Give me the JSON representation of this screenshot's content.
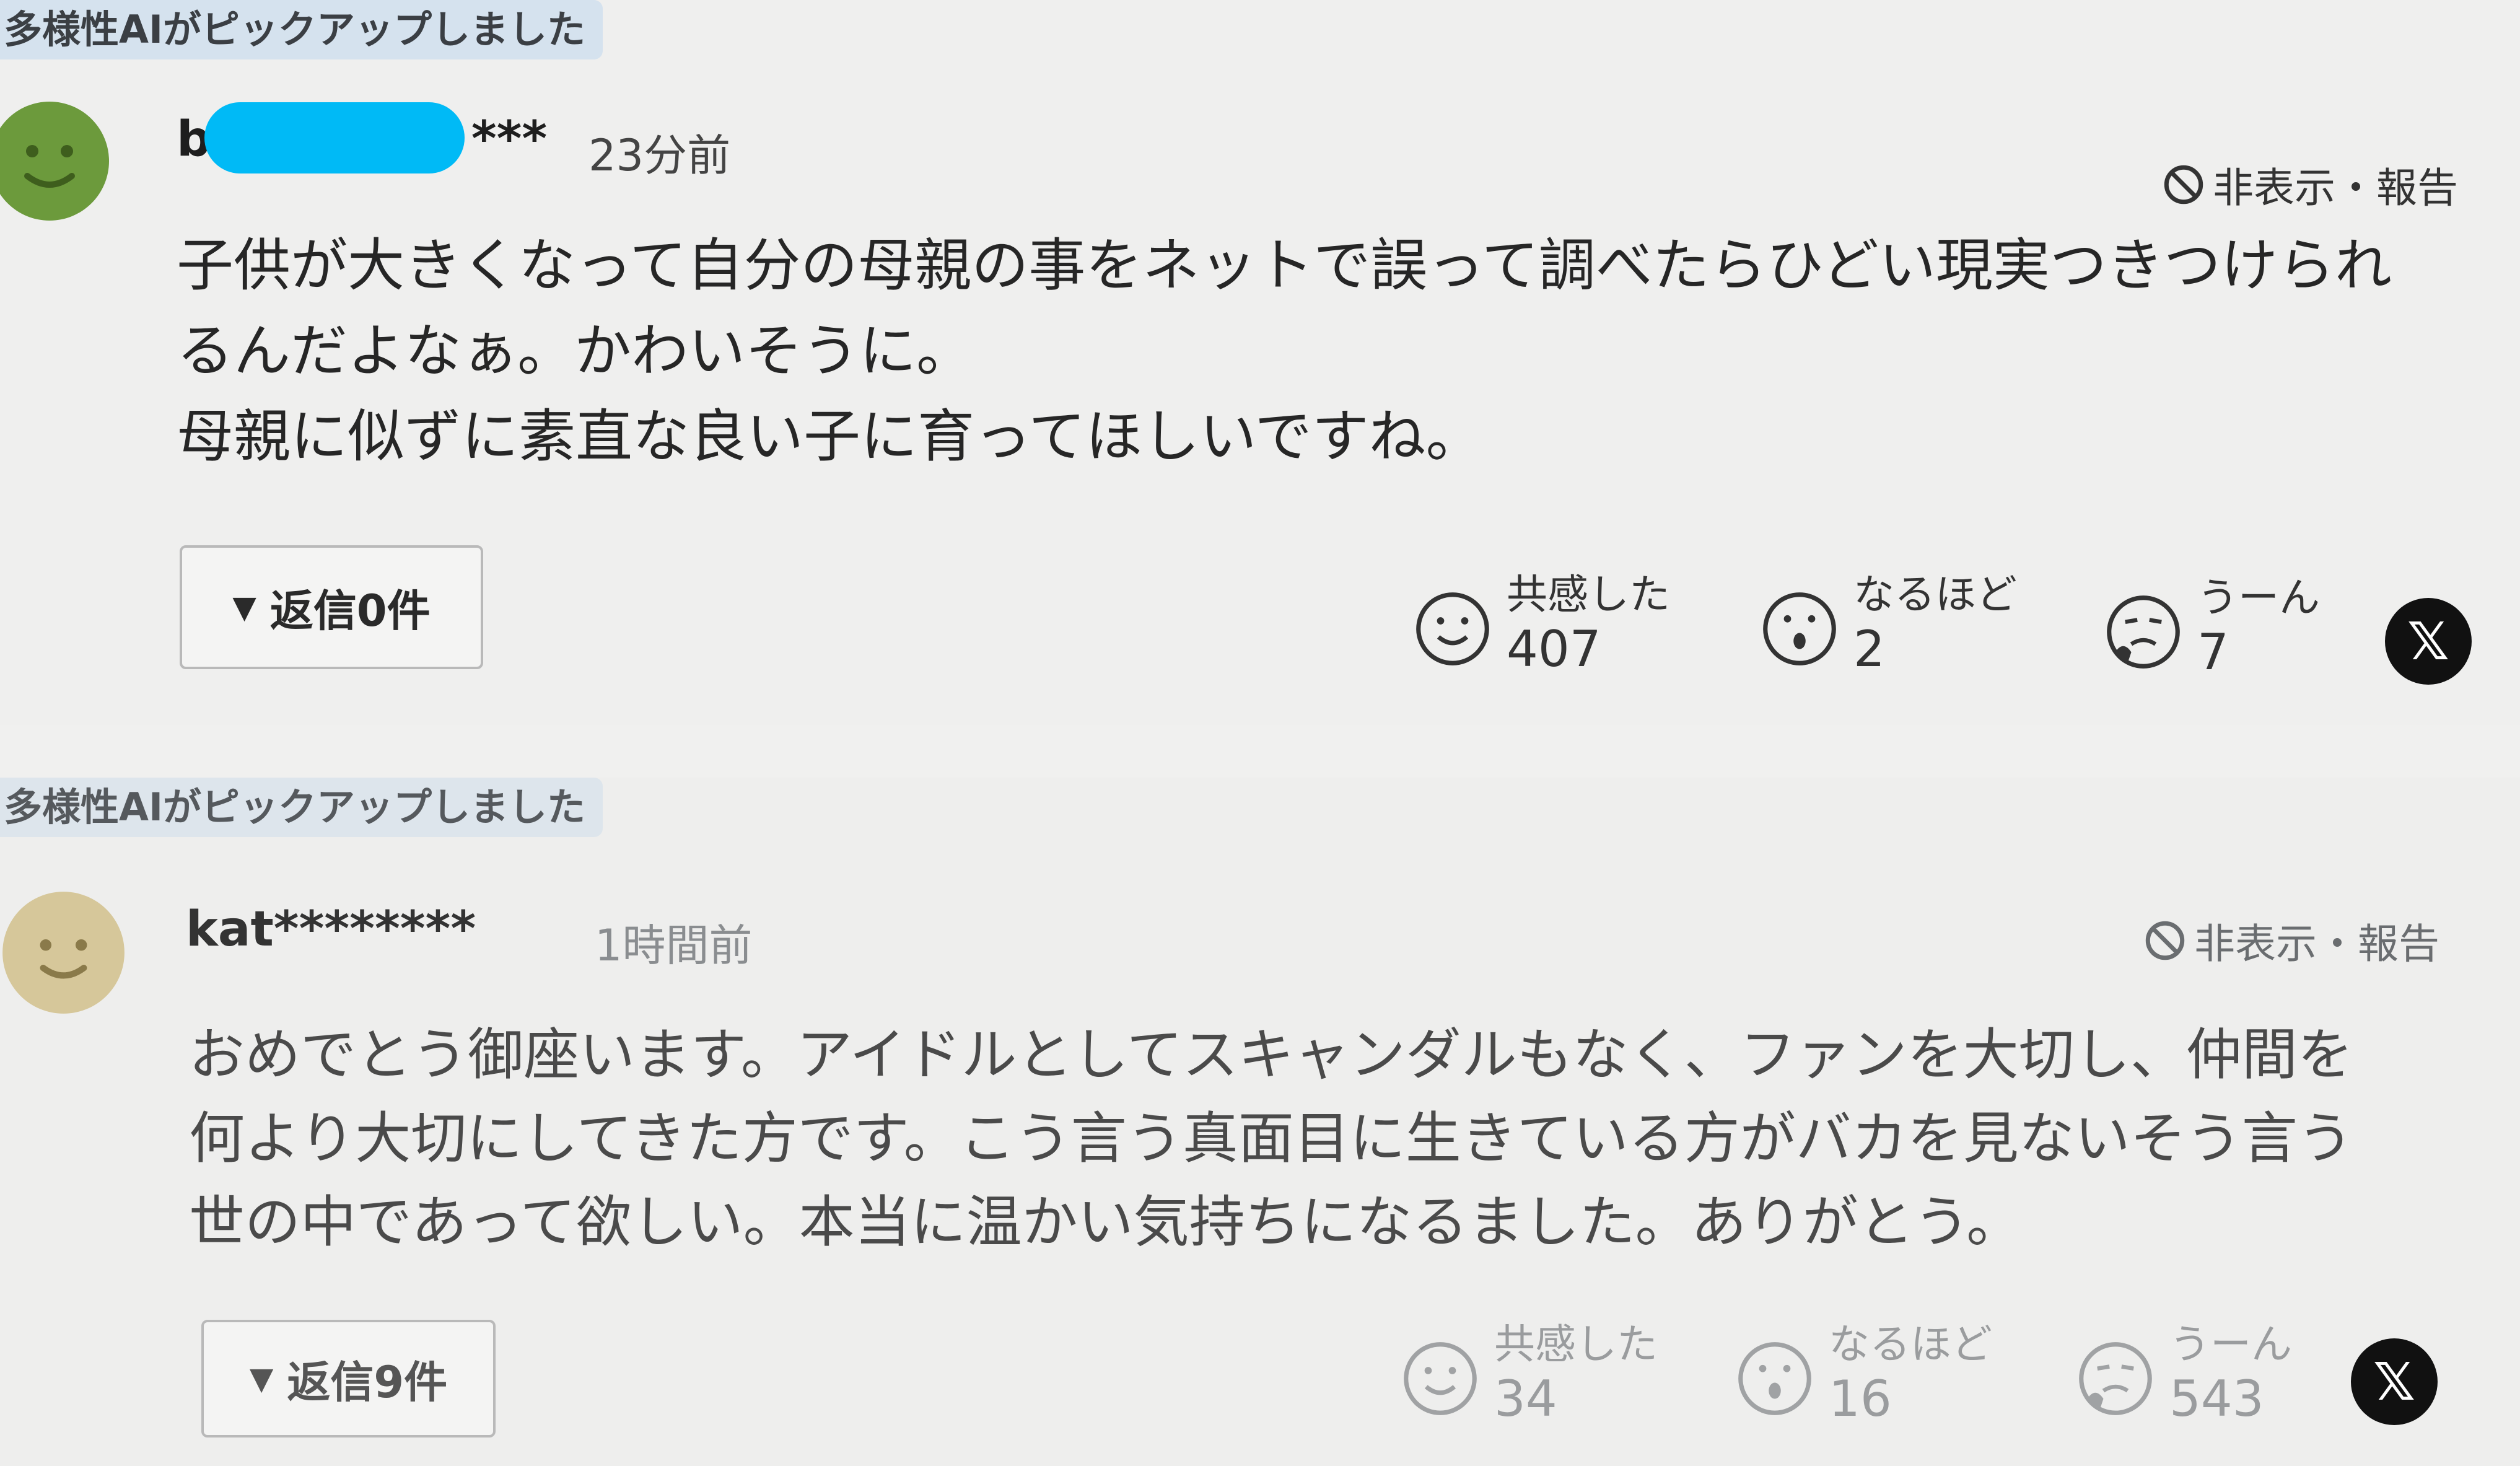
{
  "comments": [
    {
      "badge": "多様性AIがピックアップしました",
      "username": "b*** ",
      "username_visible_prefix": "b",
      "username_visible_suffix": "***",
      "time": "23分前",
      "hide_report": "非表示・報告",
      "body_lines": [
        "子供が大きくなって自分の母親の事をネットで誤って調べたらひどい現実つきつけられ",
        "るんだよなぁ。かわいそうに。",
        "母親に似ずに素直な良い子に育ってほしいですね。"
      ],
      "reply_button": "返信0件",
      "reactions": [
        {
          "label": "共感した",
          "count": "407",
          "icon": "smile-icon"
        },
        {
          "label": "なるほど",
          "count": "2",
          "icon": "surprised-icon"
        },
        {
          "label": "うーん",
          "count": "7",
          "icon": "thinking-icon"
        }
      ],
      "share": "𝕏",
      "avatar_color": "#6c9a3c"
    },
    {
      "badge": "多様性AIがピックアップしました",
      "username": "kat********",
      "time": "1時間前",
      "hide_report": "非表示・報告",
      "body_lines": [
        "おめでとう御座います。アイドルとしてスキャンダルもなく、ファンを大切し、仲間を",
        "何より大切にしてきた方です。こう言う真面目に生きている方がバカを見ないそう言う",
        "世の中であって欲しい。本当に温かい気持ちになるました。ありがとう。"
      ],
      "reply_button": "返信9件",
      "reactions": [
        {
          "label": "共感した",
          "count": "34",
          "icon": "smile-icon"
        },
        {
          "label": "なるほど",
          "count": "16",
          "icon": "surprised-icon"
        },
        {
          "label": "うーん",
          "count": "543",
          "icon": "thinking-icon"
        }
      ],
      "share": "𝕏",
      "avatar_color": "#d6c79a"
    }
  ]
}
